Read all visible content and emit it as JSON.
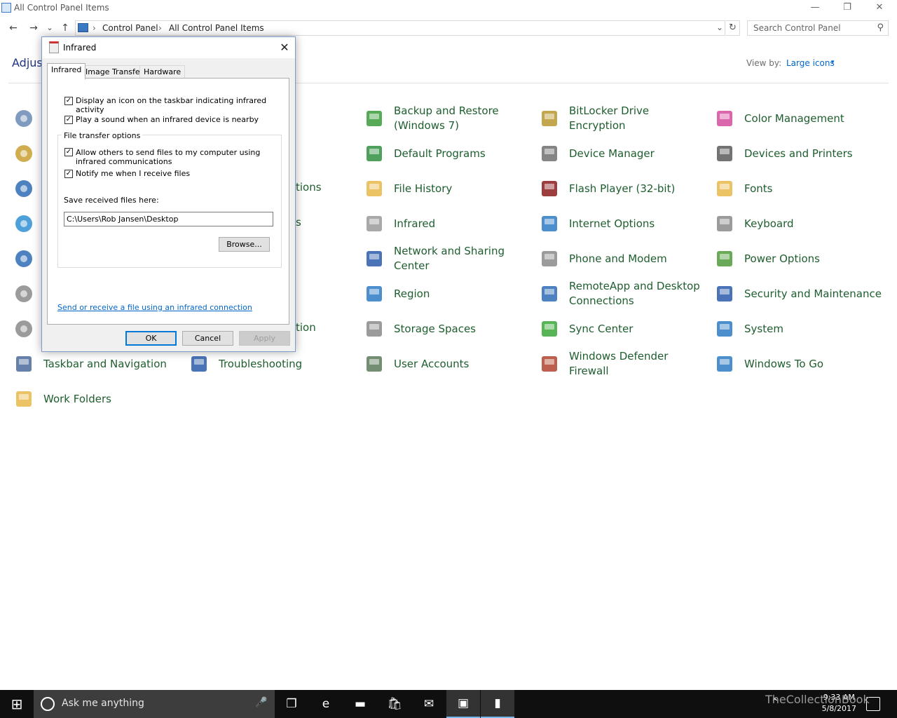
{
  "window": {
    "title": "All Control Panel Items",
    "minimize": "—",
    "maximize": "❐",
    "close": "✕"
  },
  "nav": {
    "back": "←",
    "forward": "→",
    "recent": "⌄",
    "up": "↑",
    "breadcrumb": [
      "Control Panel",
      "All Control Panel Items"
    ],
    "separator": "›",
    "dropdown": "⌄",
    "refresh": "↻"
  },
  "search": {
    "placeholder": "Search Control Panel",
    "icon": "⚲"
  },
  "header": {
    "adjust_text": "Adjus",
    "view_by_label": "View by:",
    "view_by_value": "Large icons",
    "view_by_caret": "▾"
  },
  "items": [
    {
      "label": "Backup and Restore\n(Windows 7)",
      "icon": "backup-restore-icon",
      "color": "#3a9b3a"
    },
    {
      "label": "BitLocker Drive Encryption",
      "icon": "bitlocker-icon",
      "color": "#b8962e"
    },
    {
      "label": "Color Management",
      "icon": "color-management-icon",
      "color": "#d64b9e"
    },
    {
      "label": "Default Programs",
      "icon": "default-programs-icon",
      "color": "#2f8f3f"
    },
    {
      "label": "Device Manager",
      "icon": "device-manager-icon",
      "color": "#707070"
    },
    {
      "label": "Devices and Printers",
      "icon": "devices-printers-icon",
      "color": "#5a5a5a"
    },
    {
      "label": "File History",
      "icon": "file-history-icon",
      "color": "#e8b84a"
    },
    {
      "label": "Flash Player (32-bit)",
      "icon": "flash-player-icon",
      "color": "#8c1c1c"
    },
    {
      "label": "Fonts",
      "icon": "fonts-icon",
      "color": "#e8b84a"
    },
    {
      "label": "Infrared",
      "icon": "infrared-icon",
      "color": "#9a9a9a"
    },
    {
      "label": "Internet Options",
      "icon": "internet-options-icon",
      "color": "#2e7bc4"
    },
    {
      "label": "Keyboard",
      "icon": "keyboard-icon",
      "color": "#8a8a8a"
    },
    {
      "label": "Network and Sharing\nCenter",
      "icon": "network-sharing-icon",
      "color": "#2a5caa"
    },
    {
      "label": "Phone and Modem",
      "icon": "phone-modem-icon",
      "color": "#8a8a8a"
    },
    {
      "label": "Power Options",
      "icon": "power-options-icon",
      "color": "#4f9a3a"
    },
    {
      "label": "Region",
      "icon": "region-icon",
      "color": "#2e7bc4"
    },
    {
      "label": "RemoteApp and Desktop\nConnections",
      "icon": "remoteapp-icon",
      "color": "#2e6bb4"
    },
    {
      "label": "Security and Maintenance",
      "icon": "security-maintenance-icon",
      "color": "#2a5caa"
    },
    {
      "label": "Storage Spaces",
      "icon": "storage-spaces-icon",
      "color": "#8a8a8a"
    },
    {
      "label": "Sync Center",
      "icon": "sync-center-icon",
      "color": "#3aa83a"
    },
    {
      "label": "System",
      "icon": "system-icon",
      "color": "#2e7bc4"
    },
    {
      "label": "Taskbar and Navigation",
      "icon": "taskbar-navigation-icon",
      "color": "#4a6a9a"
    },
    {
      "label": "Troubleshooting",
      "icon": "troubleshooting-icon",
      "color": "#2a5caa"
    },
    {
      "label": "User Accounts",
      "icon": "user-accounts-icon",
      "color": "#5a7a5a"
    },
    {
      "label": "Windows Defender\nFirewall",
      "icon": "firewall-icon",
      "color": "#b0442e"
    },
    {
      "label": "Windows To Go",
      "icon": "windows-to-go-icon",
      "color": "#2e7bc4"
    },
    {
      "label": "Work Folders",
      "icon": "work-folders-icon",
      "color": "#e8b84a"
    }
  ],
  "partial_labels": [
    "tions",
    "s",
    "tion"
  ],
  "left_icons": [
    {
      "icon": "administrative-tools-icon",
      "color": "#6a8ab4"
    },
    {
      "icon": "autoplay-icon",
      "color": "#c8a030"
    },
    {
      "icon": "ease-of-access-icon",
      "color": "#2e6bb4"
    },
    {
      "icon": "homegroup-icon",
      "color": "#2e8fd4"
    },
    {
      "icon": "language-icon",
      "color": "#2e6bb4"
    },
    {
      "icon": "programs-features-icon",
      "color": "#8a8a8a"
    },
    {
      "icon": "sound-icon",
      "color": "#8a8a8a"
    }
  ],
  "dialog": {
    "title": "Infrared",
    "close": "✕",
    "tabs": [
      "Infrared",
      "Image Transfer",
      "Hardware"
    ],
    "active_tab": "Infrared",
    "options": [
      {
        "label": "Display an icon on the taskbar indicating infrared activity",
        "checked": "✓"
      },
      {
        "label": "Play a sound when an infrared device is nearby",
        "checked": "✓"
      }
    ],
    "group_label": "File transfer options",
    "file_options": [
      {
        "label": "Allow others to send files to my computer using infrared communications",
        "checked": "✓"
      },
      {
        "label": "Notify me when I receive files",
        "checked": "✓"
      }
    ],
    "save_label": "Save received files here:",
    "save_path": "C:\\Users\\Rob Jansen\\Desktop",
    "browse": "Browse...",
    "link": "Send or receive a file using an infrared connection",
    "ok": "OK",
    "cancel": "Cancel",
    "apply": "Apply"
  },
  "taskbar": {
    "start": "⊞",
    "search_text": "Ask me anything",
    "mic": "🎤",
    "time": "9:33 AM",
    "date": "5/8/2017",
    "watermark": "TheCollectionBook",
    "tray_chevron": "⌃",
    "apps": [
      {
        "icon": "task-view-icon",
        "glyph": "❐"
      },
      {
        "icon": "edge-icon",
        "glyph": "e"
      },
      {
        "icon": "file-explorer-icon",
        "glyph": "▬"
      },
      {
        "icon": "store-icon",
        "glyph": "🛍"
      },
      {
        "icon": "mail-icon",
        "glyph": "✉"
      },
      {
        "icon": "control-panel-icon",
        "glyph": "▣"
      },
      {
        "icon": "infrared-app-icon",
        "glyph": "▮"
      }
    ]
  }
}
